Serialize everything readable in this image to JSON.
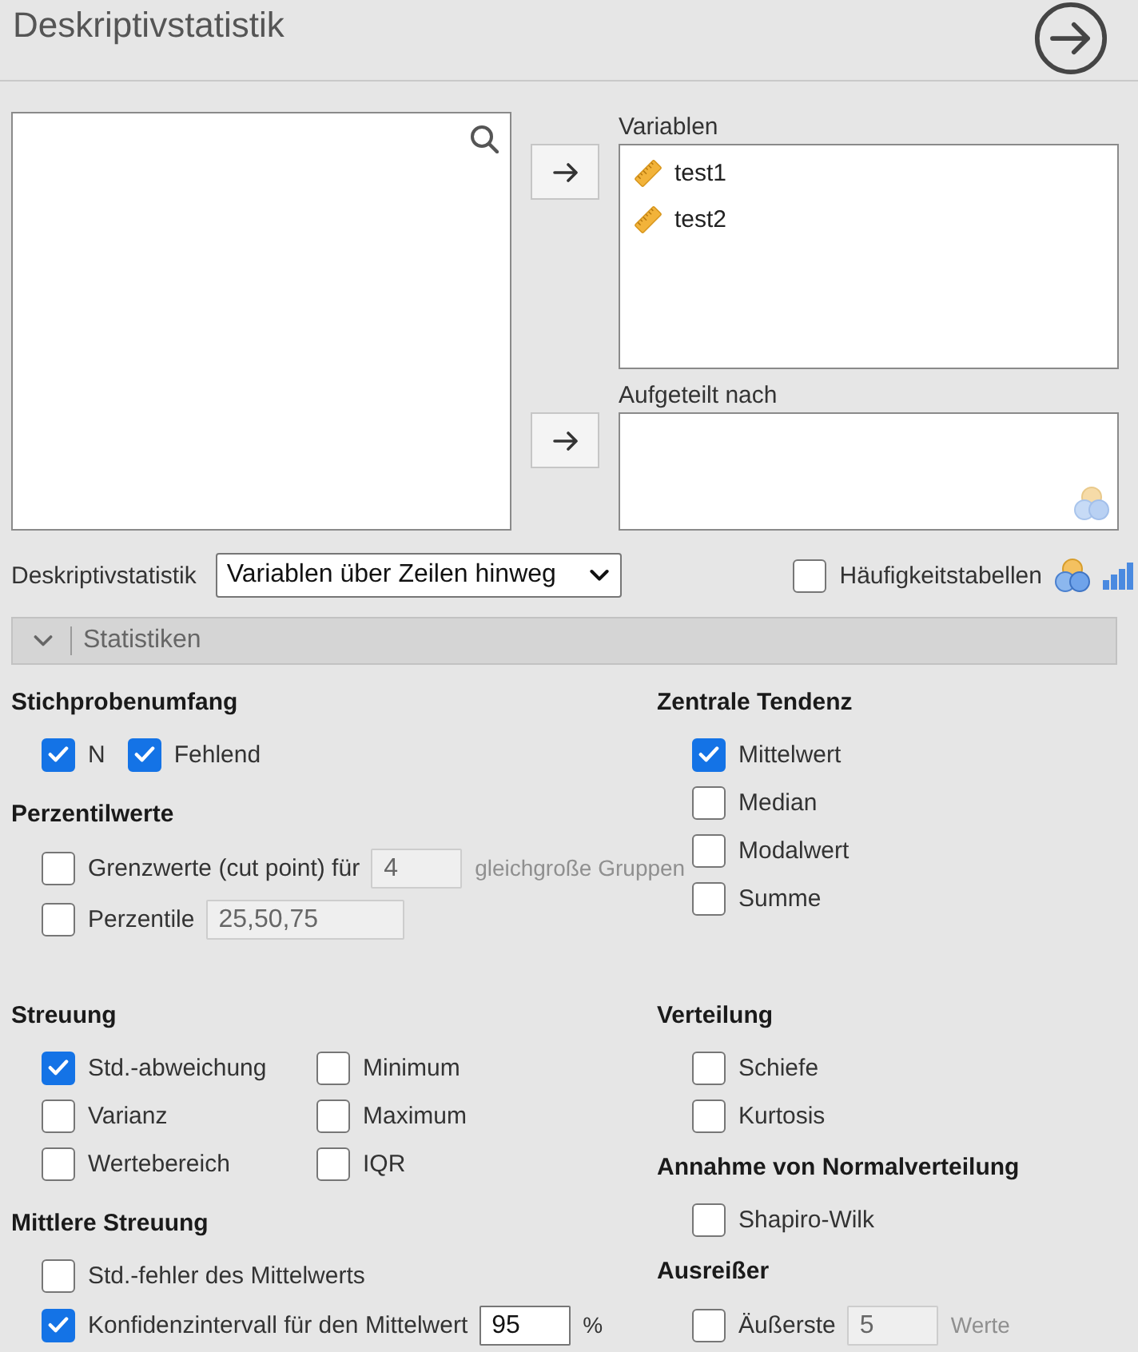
{
  "header": {
    "title": "Deskriptivstatistik"
  },
  "target_lists": [
    {
      "kind": "variables",
      "label": "Variablen",
      "items": [
        "test1",
        "test2"
      ]
    },
    {
      "kind": "split_by",
      "label": "Aufgeteilt nach"
    }
  ],
  "options_row": {
    "label": "Deskriptivstatistik",
    "dropdown": {
      "value": "Variablen über Zeilen hinweg"
    },
    "frequency_tables": {
      "label": "Häufigkeitstabellen",
      "checked": false
    }
  },
  "section": {
    "title": "Statistiken",
    "expanded": true
  },
  "blocks": [
    {
      "left": [
        {
          "title": "Stichprobenumfang",
          "kind": "inline",
          "items": [
            {
              "kind": "checkbox",
              "label": "N",
              "checked": true
            },
            {
              "kind": "checkbox",
              "label": "Fehlend",
              "checked": true
            }
          ]
        },
        {
          "title": "Perzentilwerte",
          "kind": "stack",
          "items": [
            {
              "kind": "checkbox_field",
              "label": "Grenzwerte (cut point) für",
              "checked": false,
              "value": "4",
              "suffix": "gleichgroße Gruppen"
            },
            {
              "kind": "checkbox_field",
              "label": "Perzentile",
              "checked": false,
              "value": "25,50,75"
            }
          ]
        }
      ],
      "right": [
        {
          "title": "Zentrale Tendenz",
          "kind": "stack",
          "items": [
            {
              "kind": "checkbox",
              "label": "Mittelwert",
              "checked": true
            },
            {
              "kind": "checkbox",
              "label": "Median",
              "checked": false
            },
            {
              "kind": "checkbox",
              "label": "Modalwert",
              "checked": false
            },
            {
              "kind": "checkbox",
              "label": "Summe",
              "checked": false
            }
          ]
        }
      ]
    },
    {
      "left": [
        {
          "title": "Streuung",
          "kind": "grid",
          "items": [
            {
              "kind": "checkbox",
              "label": "Std.-abweichung",
              "checked": true
            },
            {
              "kind": "checkbox",
              "label": "Minimum",
              "checked": false
            },
            {
              "kind": "checkbox",
              "label": "Varianz",
              "checked": false
            },
            {
              "kind": "checkbox",
              "label": "Maximum",
              "checked": false
            },
            {
              "kind": "checkbox",
              "label": "Wertebereich",
              "checked": false
            },
            {
              "kind": "checkbox",
              "label": "IQR",
              "checked": false
            }
          ]
        },
        {
          "title": "Mittlere Streuung",
          "kind": "stack",
          "items": [
            {
              "kind": "checkbox",
              "label": "Std.-fehler des Mittelwerts",
              "checked": false
            },
            {
              "kind": "checkbox_field",
              "label": "Konfidenzintervall für den Mittelwert",
              "checked": true,
              "value": "95",
              "suffix": "%"
            }
          ]
        }
      ],
      "right": [
        {
          "title": "Verteilung",
          "kind": "stack",
          "items": [
            {
              "kind": "checkbox",
              "label": "Schiefe",
              "checked": false
            },
            {
              "kind": "checkbox",
              "label": "Kurtosis",
              "checked": false
            }
          ]
        },
        {
          "title": "Annahme von Normalverteilung",
          "kind": "stack",
          "items": [
            {
              "kind": "checkbox",
              "label": "Shapiro-Wilk",
              "checked": false
            }
          ]
        },
        {
          "title": "Ausreißer",
          "kind": "stack",
          "items": [
            {
              "kind": "checkbox_field",
              "label": "Äußerste",
              "checked": false,
              "value": "5",
              "suffix": "Werte"
            }
          ]
        }
      ]
    }
  ]
}
